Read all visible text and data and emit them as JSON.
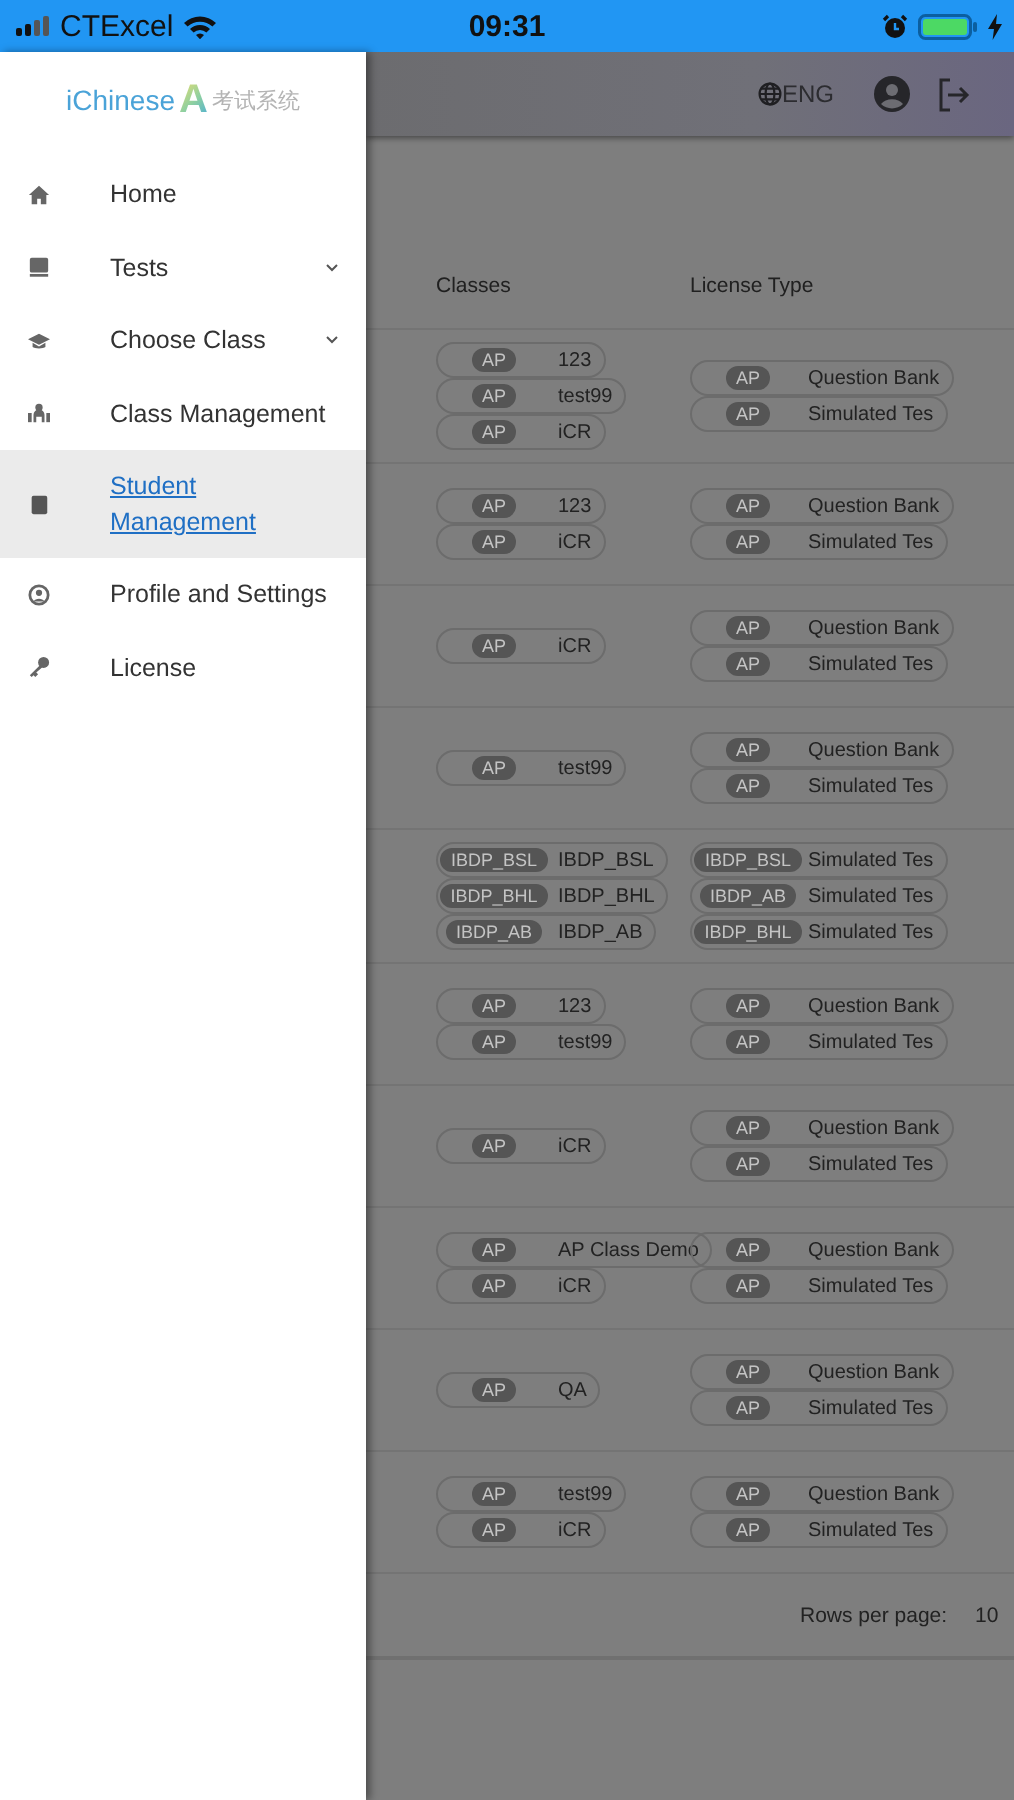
{
  "status_bar": {
    "carrier": "CTExcel",
    "time": "09:31"
  },
  "drawer": {
    "logo": {
      "brand": "iChinese",
      "mark": "A",
      "subtitle": "考试系统"
    },
    "items": [
      {
        "label": "Home",
        "expandable": false,
        "selected": false
      },
      {
        "label": "Tests",
        "expandable": true,
        "selected": false
      },
      {
        "label": "Choose Class",
        "expandable": true,
        "selected": false
      },
      {
        "label": "Class Management",
        "expandable": false,
        "selected": false
      },
      {
        "label": "Student Management",
        "expandable": false,
        "selected": true
      },
      {
        "label": "Profile and Settings",
        "expandable": false,
        "selected": false
      },
      {
        "label": "License",
        "expandable": false,
        "selected": false
      }
    ]
  },
  "header": {
    "language": "ENG"
  },
  "table": {
    "columns": [
      "Classes",
      "License Type"
    ],
    "rows": [
      {
        "classes": [
          {
            "tag": "AP",
            "name": "123"
          },
          {
            "tag": "AP",
            "name": "test99"
          },
          {
            "tag": "AP",
            "name": "iCR"
          }
        ],
        "licenses": [
          {
            "tag": "AP",
            "name": "Question Bank"
          },
          {
            "tag": "AP",
            "name": "Simulated Tes"
          }
        ]
      },
      {
        "classes": [
          {
            "tag": "AP",
            "name": "123"
          },
          {
            "tag": "AP",
            "name": "iCR"
          }
        ],
        "licenses": [
          {
            "tag": "AP",
            "name": "Question Bank"
          },
          {
            "tag": "AP",
            "name": "Simulated Tes"
          }
        ]
      },
      {
        "classes": [
          {
            "tag": "AP",
            "name": "iCR"
          }
        ],
        "licenses": [
          {
            "tag": "AP",
            "name": "Question Bank"
          },
          {
            "tag": "AP",
            "name": "Simulated Tes"
          }
        ]
      },
      {
        "classes": [
          {
            "tag": "AP",
            "name": "test99"
          }
        ],
        "licenses": [
          {
            "tag": "AP",
            "name": "Question Bank"
          },
          {
            "tag": "AP",
            "name": "Simulated Tes"
          }
        ]
      },
      {
        "classes": [
          {
            "tag": "IBDP_BSL",
            "name": "IBDP_BSL"
          },
          {
            "tag": "IBDP_BHL",
            "name": "IBDP_BHL"
          },
          {
            "tag": "IBDP_AB",
            "name": "IBDP_AB"
          }
        ],
        "licenses": [
          {
            "tag": "IBDP_BSL",
            "name": "Simulated Tes"
          },
          {
            "tag": "IBDP_AB",
            "name": "Simulated Tes"
          },
          {
            "tag": "IBDP_BHL",
            "name": "Simulated Tes"
          }
        ]
      },
      {
        "classes": [
          {
            "tag": "AP",
            "name": "123"
          },
          {
            "tag": "AP",
            "name": "test99"
          }
        ],
        "licenses": [
          {
            "tag": "AP",
            "name": "Question Bank"
          },
          {
            "tag": "AP",
            "name": "Simulated Tes"
          }
        ]
      },
      {
        "classes": [
          {
            "tag": "AP",
            "name": "iCR"
          }
        ],
        "licenses": [
          {
            "tag": "AP",
            "name": "Question Bank"
          },
          {
            "tag": "AP",
            "name": "Simulated Tes"
          }
        ]
      },
      {
        "classes": [
          {
            "tag": "AP",
            "name": "AP Class Demo"
          },
          {
            "tag": "AP",
            "name": "iCR"
          }
        ],
        "licenses": [
          {
            "tag": "AP",
            "name": "Question Bank"
          },
          {
            "tag": "AP",
            "name": "Simulated Tes"
          }
        ]
      },
      {
        "classes": [
          {
            "tag": "AP",
            "name": "QA"
          }
        ],
        "licenses": [
          {
            "tag": "AP",
            "name": "Question Bank"
          },
          {
            "tag": "AP",
            "name": "Simulated Tes"
          }
        ]
      },
      {
        "classes": [
          {
            "tag": "AP",
            "name": "test99"
          },
          {
            "tag": "AP",
            "name": "iCR"
          }
        ],
        "licenses": [
          {
            "tag": "AP",
            "name": "Question Bank"
          },
          {
            "tag": "AP",
            "name": "Simulated Tes"
          }
        ]
      }
    ]
  },
  "pagination": {
    "label": "Rows per page:",
    "value": "10"
  }
}
